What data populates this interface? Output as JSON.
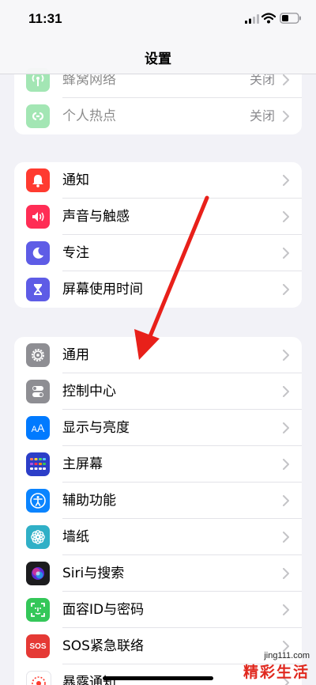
{
  "status_bar": {
    "time": "11:31"
  },
  "nav": {
    "title": "设置"
  },
  "group1": [
    {
      "label": "蜂窝网络",
      "value": "关闭",
      "icon": "antenna-icon",
      "color": "#34c759"
    },
    {
      "label": "个人热点",
      "value": "关闭",
      "icon": "hotspot-icon",
      "color": "#34c759"
    }
  ],
  "group2": [
    {
      "label": "通知",
      "icon": "bell-icon",
      "color": "#ff3b30"
    },
    {
      "label": "声音与触感",
      "icon": "speaker-icon",
      "color": "#ff2d55"
    },
    {
      "label": "专注",
      "icon": "moon-icon",
      "color": "#5e5ce6"
    },
    {
      "label": "屏幕使用时间",
      "icon": "hourglass-icon",
      "color": "#5e5ce6"
    }
  ],
  "group3": [
    {
      "label": "通用",
      "icon": "gear-icon",
      "color": "#8e8e93"
    },
    {
      "label": "控制中心",
      "icon": "toggles-icon",
      "color": "#8e8e93"
    },
    {
      "label": "显示与亮度",
      "icon": "text-size-icon",
      "color": "#007aff"
    },
    {
      "label": "主屏幕",
      "icon": "home-grid-icon",
      "color": "#2c3ec8"
    },
    {
      "label": "辅助功能",
      "icon": "accessibility-icon",
      "color": "#0a84ff"
    },
    {
      "label": "墙纸",
      "icon": "flower-icon",
      "color": "#30b0c7"
    },
    {
      "label": "Siri与搜索",
      "icon": "siri-icon",
      "color": "#1c1c1e"
    },
    {
      "label": "面容ID与密码",
      "icon": "face-id-icon",
      "color": "#34c759"
    },
    {
      "label": "SOS紧急联络",
      "icon": "sos-icon",
      "color": "#e53935"
    },
    {
      "label": "暴露通知",
      "icon": "exposure-icon",
      "color": "#ffffff"
    }
  ],
  "watermark": {
    "url": "jing111.com",
    "text": "精彩生活"
  }
}
